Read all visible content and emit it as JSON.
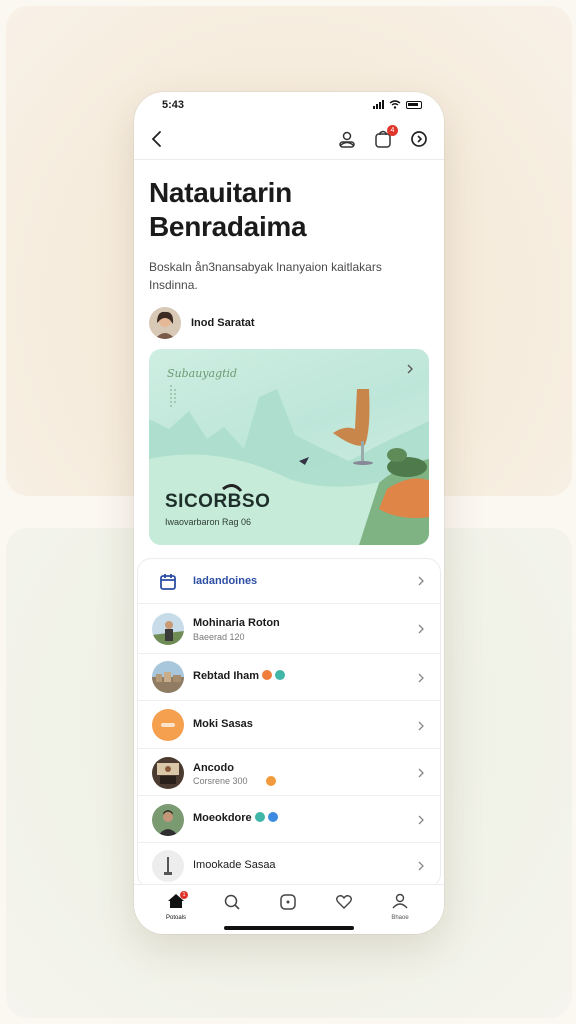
{
  "status_bar": {
    "time": "5:43"
  },
  "header": {
    "notification_count": "4"
  },
  "article": {
    "title_line1": "Natauitarin",
    "title_line2": "Benradaima",
    "description": "Boskaln ån3nansabyak lnanyaion kaitlakars Insdinna.",
    "author_name": "Inod Saratat"
  },
  "featured_card": {
    "script_text": "Subauyagtid",
    "big_text": "SICORBSO",
    "small_text": "Iwaovarbaron Rag 06"
  },
  "list": [
    {
      "title": "Iadandoines",
      "subtitle": "",
      "icon": "calendar-icon"
    },
    {
      "title": "Mohinaria Roton",
      "subtitle": "Baeerad 120",
      "icon": "person-avatar"
    },
    {
      "title": "Rebtad Iham",
      "subtitle": "",
      "icon": "city-thumb"
    },
    {
      "title": "Moki Sasas",
      "subtitle": "",
      "icon": "orange-avatar"
    },
    {
      "title": "Ancodo",
      "subtitle": "Corsrene 300",
      "icon": "interior-thumb"
    },
    {
      "title": "Moeokdore",
      "subtitle": "",
      "icon": "person-avatar-2"
    },
    {
      "title": "Imookade Sasaa",
      "subtitle": "",
      "icon": "statue-thumb"
    }
  ],
  "tabbar": {
    "home_label": "Potoals",
    "profile_label": "Bhaoe",
    "home_badge": "1"
  },
  "colors": {
    "accent_blue": "#2c4ea3",
    "badge_red": "#e0352b",
    "dot_orange": "#ef7d3c",
    "dot_teal": "#3fb6a8",
    "dot_blue": "#3d8be0"
  }
}
